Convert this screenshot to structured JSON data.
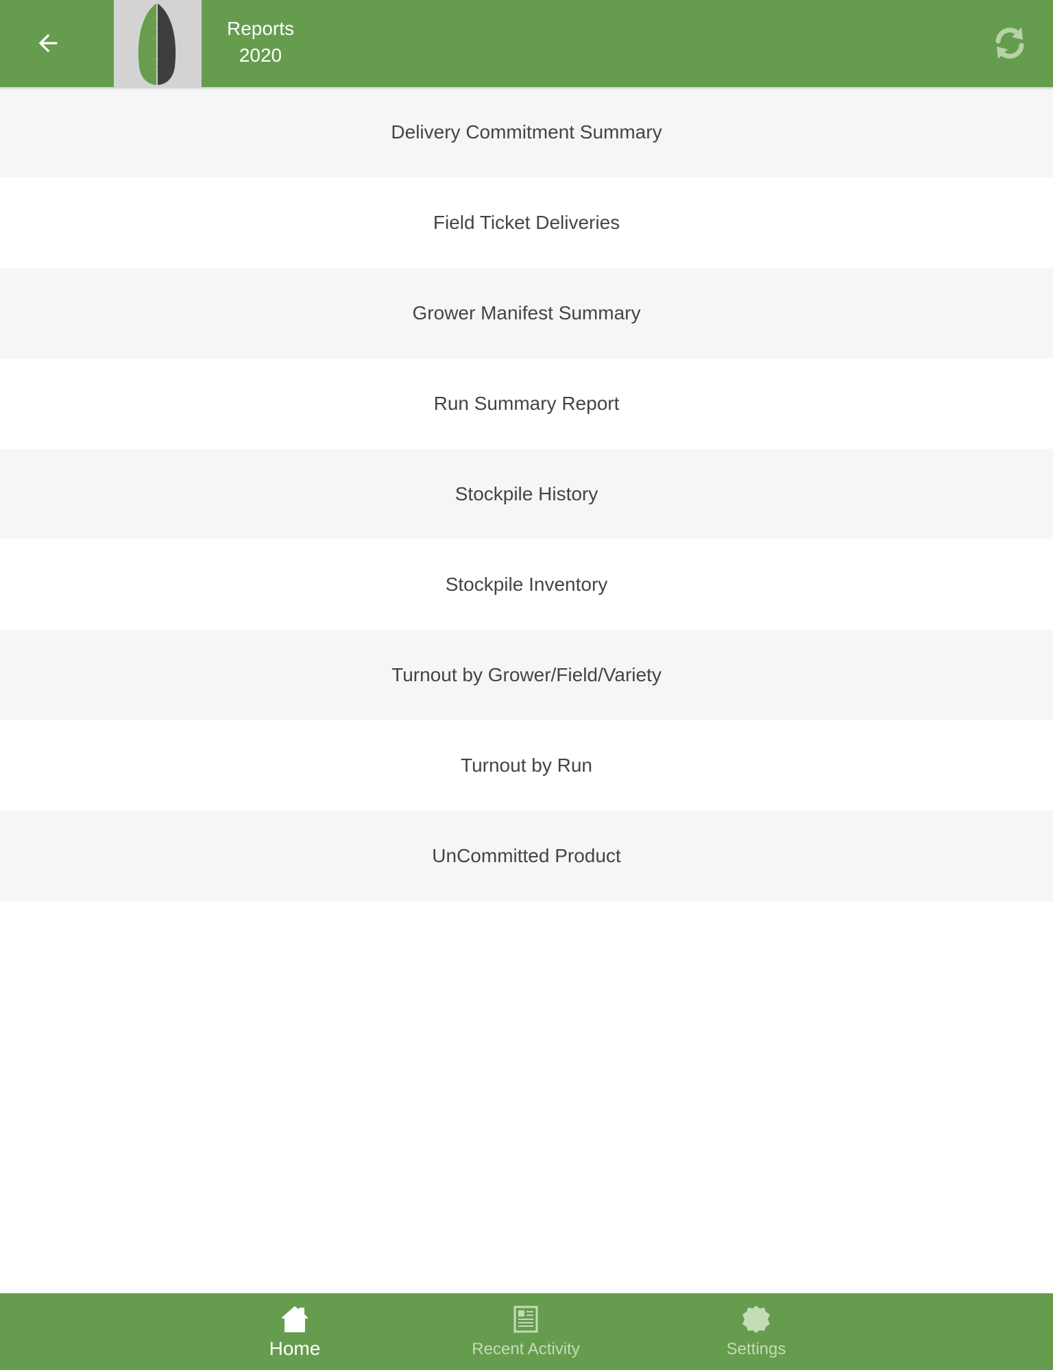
{
  "header": {
    "title_line1": "Reports",
    "title_line2": "2020",
    "back_icon": "arrow-left-icon",
    "logo_icon": "leaf-logo-icon",
    "refresh_icon": "refresh-icon"
  },
  "reports": [
    {
      "label": "Delivery Commitment Summary"
    },
    {
      "label": "Field Ticket Deliveries"
    },
    {
      "label": "Grower Manifest Summary"
    },
    {
      "label": "Run Summary Report"
    },
    {
      "label": "Stockpile History"
    },
    {
      "label": "Stockpile Inventory"
    },
    {
      "label": "Turnout by Grower/Field/Variety"
    },
    {
      "label": "Turnout by Run"
    },
    {
      "label": "UnCommitted Product"
    }
  ],
  "bottom_nav": {
    "items": [
      {
        "label": "Home",
        "icon": "home-icon",
        "active": true
      },
      {
        "label": "Recent Activity",
        "icon": "document-icon",
        "active": false
      },
      {
        "label": "Settings",
        "icon": "badge-icon",
        "active": false
      }
    ]
  },
  "colors": {
    "brand_green": "#669c4e",
    "row_alt": "#f6f6f6",
    "text": "#444444",
    "inactive_nav": "#c4dcb6"
  }
}
